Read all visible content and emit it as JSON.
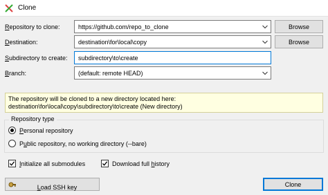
{
  "window": {
    "title": "Clone"
  },
  "form": {
    "repo_label_pre": "",
    "repo_label_u": "R",
    "repo_label_post": "epository to clone:",
    "repo_value": "https://github.com/repo_to_clone",
    "dest_label_u": "D",
    "dest_label_post": "estination:",
    "dest_value": "destination\\for\\local\\copy",
    "sub_label_u": "S",
    "sub_label_post": "ubdirectory to create:",
    "sub_value": "subdirectory\\to\\create",
    "branch_label_u": "B",
    "branch_label_post": "ranch:",
    "branch_value": "(default: remote HEAD)",
    "browse_label_1": "Browse",
    "browse_label_2": "Browse"
  },
  "info": {
    "line1": "The repository will be cloned to a new directory located here:",
    "line2": "destination\\for\\local\\copy\\subdirectory\\to\\create (New directory)"
  },
  "repo_type": {
    "title": "Repository type",
    "personal_u": "P",
    "personal_post": "ersonal repository",
    "public_pre": "P",
    "public_u": "u",
    "public_post": "blic repository, no working directory  (--bare)",
    "selected": "personal"
  },
  "options": {
    "submodules_pre": "",
    "submodules_u": "I",
    "submodules_post": "nitialize all submodules",
    "submodules_checked": true,
    "history_pre": "Download full ",
    "history_u": "h",
    "history_post": "istory",
    "history_checked": true
  },
  "actions": {
    "load_ssh_pre": "",
    "load_ssh_u": "L",
    "load_ssh_post": "oad SSH key",
    "clone_label": "Clone"
  },
  "colors": {
    "accent": "#0078d7",
    "info_bg": "#ffffe1"
  }
}
